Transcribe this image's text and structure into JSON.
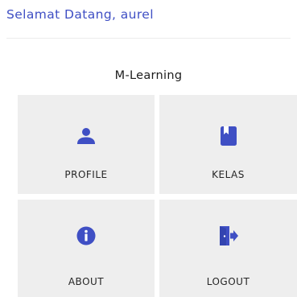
{
  "header": {
    "greeting": "Selamat Datang, aurel"
  },
  "app": {
    "title": "M-Learning"
  },
  "menu": {
    "items": [
      {
        "label": "PROFILE",
        "icon": "person-icon"
      },
      {
        "label": "KELAS",
        "icon": "book-icon"
      },
      {
        "label": "ABOUT",
        "icon": "info-icon"
      },
      {
        "label": "LOGOUT",
        "icon": "logout-icon"
      }
    ]
  },
  "colors": {
    "accent": "#3f4fc4",
    "tile_background": "#eeeeee",
    "greeting_text": "#3f4fc4"
  }
}
